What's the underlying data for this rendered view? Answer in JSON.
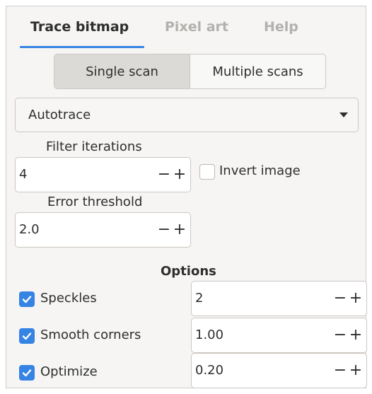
{
  "tabs": [
    {
      "label": "Trace bitmap",
      "active": true
    },
    {
      "label": "Pixel art",
      "active": false
    },
    {
      "label": "Help",
      "active": false
    }
  ],
  "scan_mode": {
    "options": [
      "Single scan",
      "Multiple scans"
    ],
    "selected": "Single scan"
  },
  "method_dropdown": {
    "value": "Autotrace"
  },
  "filter_iterations": {
    "label": "Filter iterations",
    "value": "4"
  },
  "invert_image": {
    "label": "Invert image",
    "checked": false
  },
  "error_threshold": {
    "label": "Error threshold",
    "value": "2.0"
  },
  "options": {
    "heading": "Options",
    "items": [
      {
        "label": "Speckles",
        "checked": true,
        "value": "2"
      },
      {
        "label": "Smooth corners",
        "checked": true,
        "value": "1.00"
      },
      {
        "label": "Optimize",
        "checked": true,
        "value": "0.20"
      }
    ]
  },
  "glyphs": {
    "minus": "−",
    "plus": "+"
  },
  "colors": {
    "accent": "#3584e4",
    "panel": "#f6f5f4",
    "dim_text": "#b3b1ae"
  }
}
